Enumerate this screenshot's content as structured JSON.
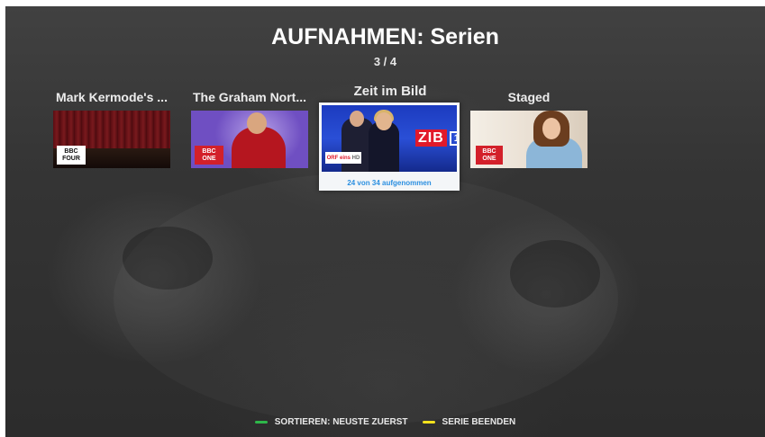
{
  "header": {
    "title": "AUFNAHMEN: Serien",
    "counter": "3 / 4"
  },
  "cards": [
    {
      "title": "Mark Kermode's ...",
      "channel_logo": "BBC FOUR",
      "channel_top": "BBC",
      "channel_bottom": "FOUR"
    },
    {
      "title": "The Graham Nort...",
      "channel_logo": "BBC ONE",
      "channel_top": "BBC",
      "channel_bottom": "ONE"
    },
    {
      "title": "Zeit im Bild",
      "channel_logo": "ORF eins HD",
      "logo_parts": [
        "ORF",
        "eins",
        "HD"
      ],
      "zib_text": "ZIB",
      "zib_number": "1",
      "caption": "24 von 34 aufgenommen",
      "selected": true
    },
    {
      "title": "Staged",
      "channel_logo": "BBC ONE",
      "channel_top": "BBC",
      "channel_bottom": "ONE"
    }
  ],
  "footer": {
    "hints": [
      {
        "label": "SORTIEREN: NEUSTE ZUERST",
        "color": "#2eb84a"
      },
      {
        "label": "SERIE BEENDEN",
        "color": "#f2e11d"
      }
    ]
  },
  "colors": {
    "selection_caption": "#2b8fe0",
    "bbc_one_red": "#d3202a"
  }
}
